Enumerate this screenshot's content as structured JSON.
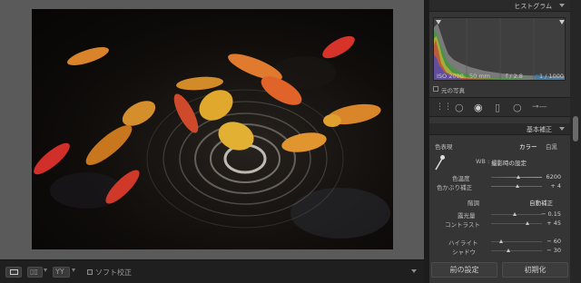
{
  "panels": {
    "histogram": {
      "title": "ヒストグラム"
    },
    "basic": {
      "title": "基本補正"
    }
  },
  "histogram_info": {
    "iso": "ISO 2000",
    "focal": "50 mm",
    "aperture": "f / 2.8",
    "shutter": "1 / 1000",
    "original_photo_label": "元の写真"
  },
  "basic": {
    "treatment_label": "色表現",
    "treatment_options": [
      "カラー",
      "白黒"
    ],
    "wb_label": "WB :",
    "wb_value": "撮影時の設定",
    "temp_label": "色温度",
    "temp_value": "6200",
    "temp_level": 0.55,
    "tint_label": "色かぶり補正",
    "tint_value": "+ 4",
    "tint_level": 0.52,
    "tone_label": "階調",
    "auto_label": "自動補正",
    "exposure_label": "露光量",
    "exposure_value": "− 0.15",
    "exposure_level": 0.48,
    "contrast_label": "コントラスト",
    "contrast_value": "+ 45",
    "contrast_level": 0.72,
    "highlights_label": "ハイライト",
    "highlights_value": "− 60",
    "highlights_level": 0.2,
    "shadows_label": "シャドウ",
    "shadows_value": "− 30",
    "shadows_level": 0.35
  },
  "bottom_buttons": {
    "previous": "前の設定",
    "reset": "初期化"
  },
  "toolbar": {
    "soft_proof_label": "ソフト校正",
    "view_modes": [
      "loupe",
      "before-after-lr",
      "before-after-tb"
    ]
  },
  "icons": {
    "eyedropper": "eyedropper-icon",
    "crop": "crop-grid-icon",
    "spot": "spot-removal-icon",
    "redeye": "red-eye-icon",
    "gradient": "graduated-filter-icon",
    "radial": "radial-filter-icon",
    "brush": "adjustment-brush-icon"
  },
  "colors": {
    "panel_bg": "#353535",
    "canvas_bg": "#5a5a5a",
    "accent_text": "#ffffff"
  }
}
